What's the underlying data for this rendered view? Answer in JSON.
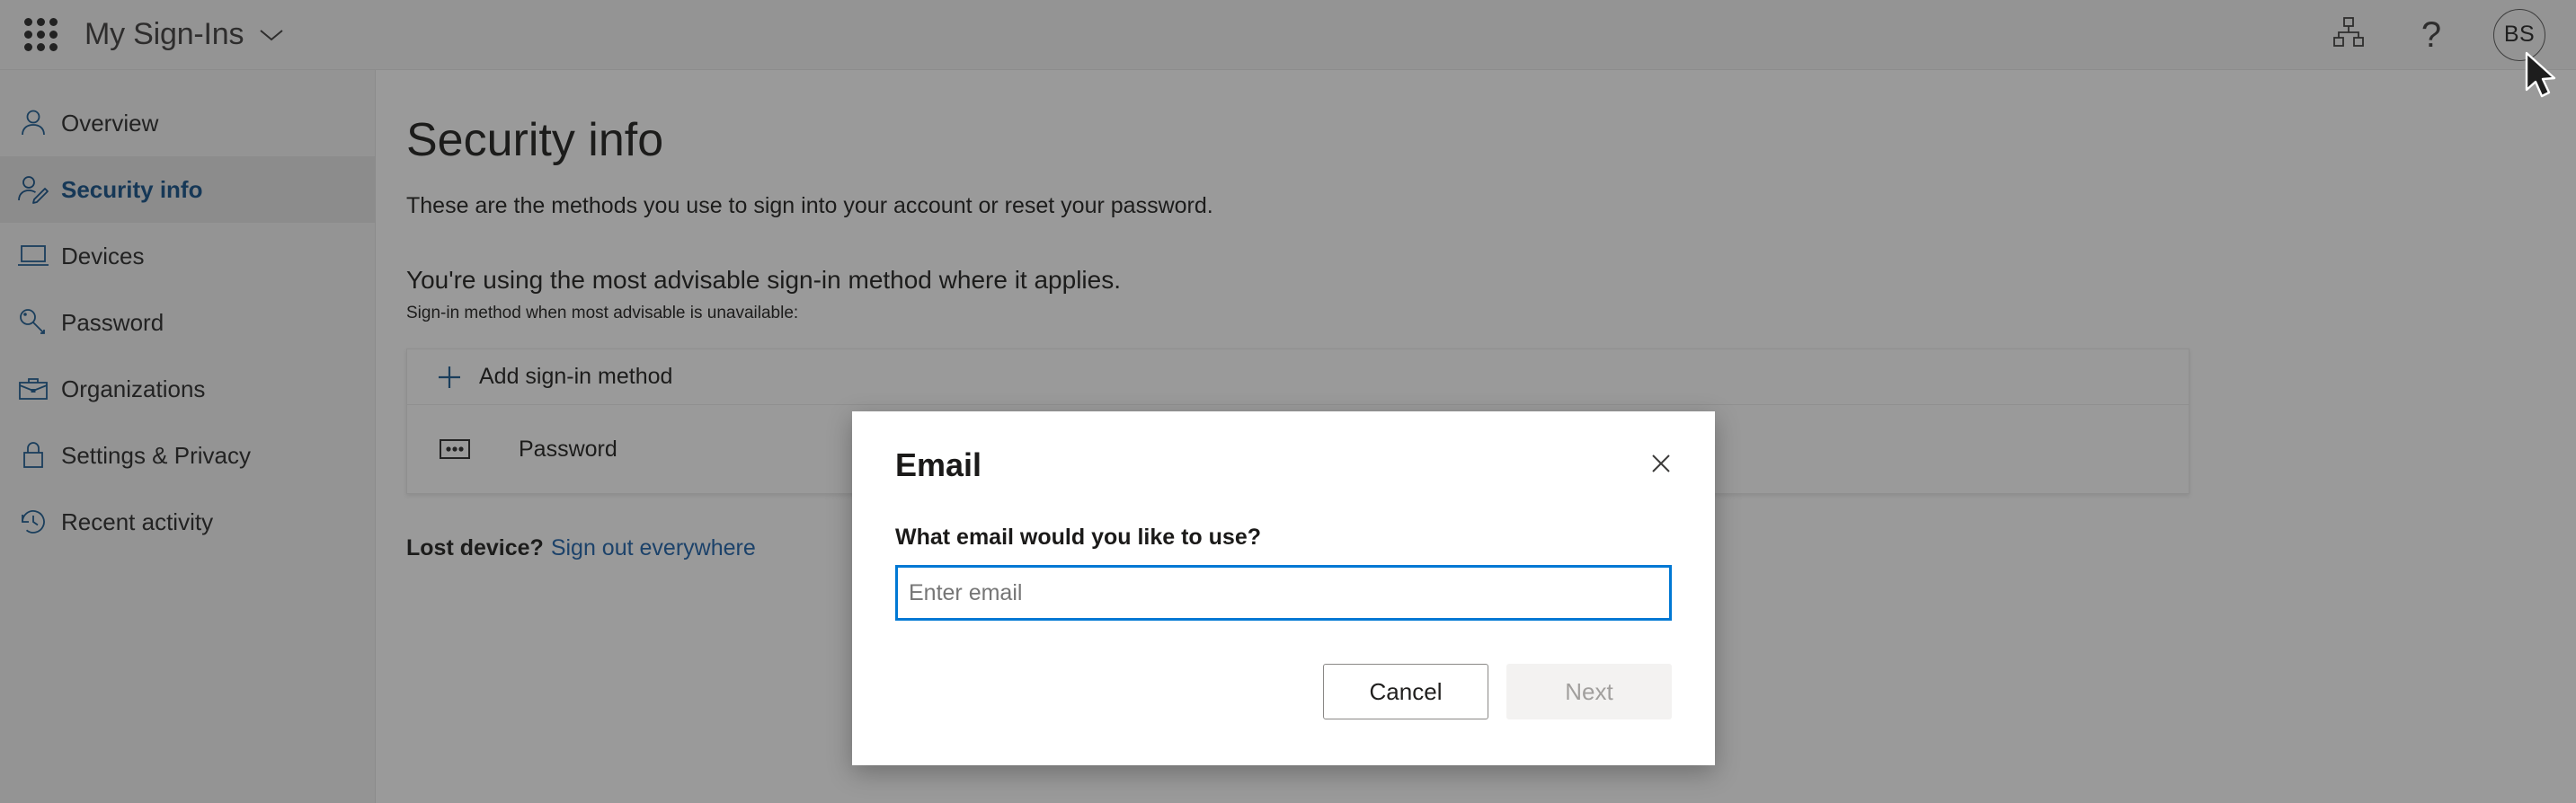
{
  "header": {
    "waffle_icon": "app-launcher-waffle-icon",
    "app_title": "My Sign-Ins",
    "title_chevron_icon": "chevron-down-icon",
    "org_icon": "org-hierarchy-icon",
    "help_icon": "question-mark-icon",
    "help_glyph": "?",
    "avatar_initials": "BS"
  },
  "sidebar": {
    "items": [
      {
        "label": "Overview",
        "icon": "person-icon",
        "selected": false
      },
      {
        "label": "Security info",
        "icon": "person-edit-icon",
        "selected": true
      },
      {
        "label": "Devices",
        "icon": "laptop-icon",
        "selected": false
      },
      {
        "label": "Password",
        "icon": "key-icon",
        "selected": false
      },
      {
        "label": "Organizations",
        "icon": "briefcase-icon",
        "selected": false
      },
      {
        "label": "Settings & Privacy",
        "icon": "lock-icon",
        "selected": false
      },
      {
        "label": "Recent activity",
        "icon": "history-clock-icon",
        "selected": false
      }
    ]
  },
  "main": {
    "page_title": "Security info",
    "description": "These are the methods you use to sign into your account or reset your password.",
    "advisable_heading": "You're using the most advisable sign-in method where it applies.",
    "advisable_note": "Sign-in method when most advisable is unavailable:",
    "add_method": {
      "label": "Add sign-in method",
      "icon": "plus-icon"
    },
    "methods": [
      {
        "label": "Password",
        "icon": "password-dots-icon"
      }
    ],
    "lost_device": {
      "prefix": "Lost device?",
      "link": "Sign out everywhere"
    }
  },
  "dialog": {
    "title": "Email",
    "close_icon": "close-x-icon",
    "question": "What email would you like to use?",
    "input_value": "",
    "input_placeholder": "Enter email",
    "cancel_label": "Cancel",
    "next_label": "Next",
    "next_disabled": true
  },
  "colors": {
    "accent_blue": "#0078d4",
    "link_blue": "#1a5fa8",
    "nav_icon_blue": "#17588f",
    "selected_nav_text": "#0f4d86",
    "text_primary": "#1b1a19",
    "disabled_text": "#a19f9d",
    "disabled_bg": "#f3f2f1",
    "overlay": "rgba(32,32,32,0.45)"
  }
}
